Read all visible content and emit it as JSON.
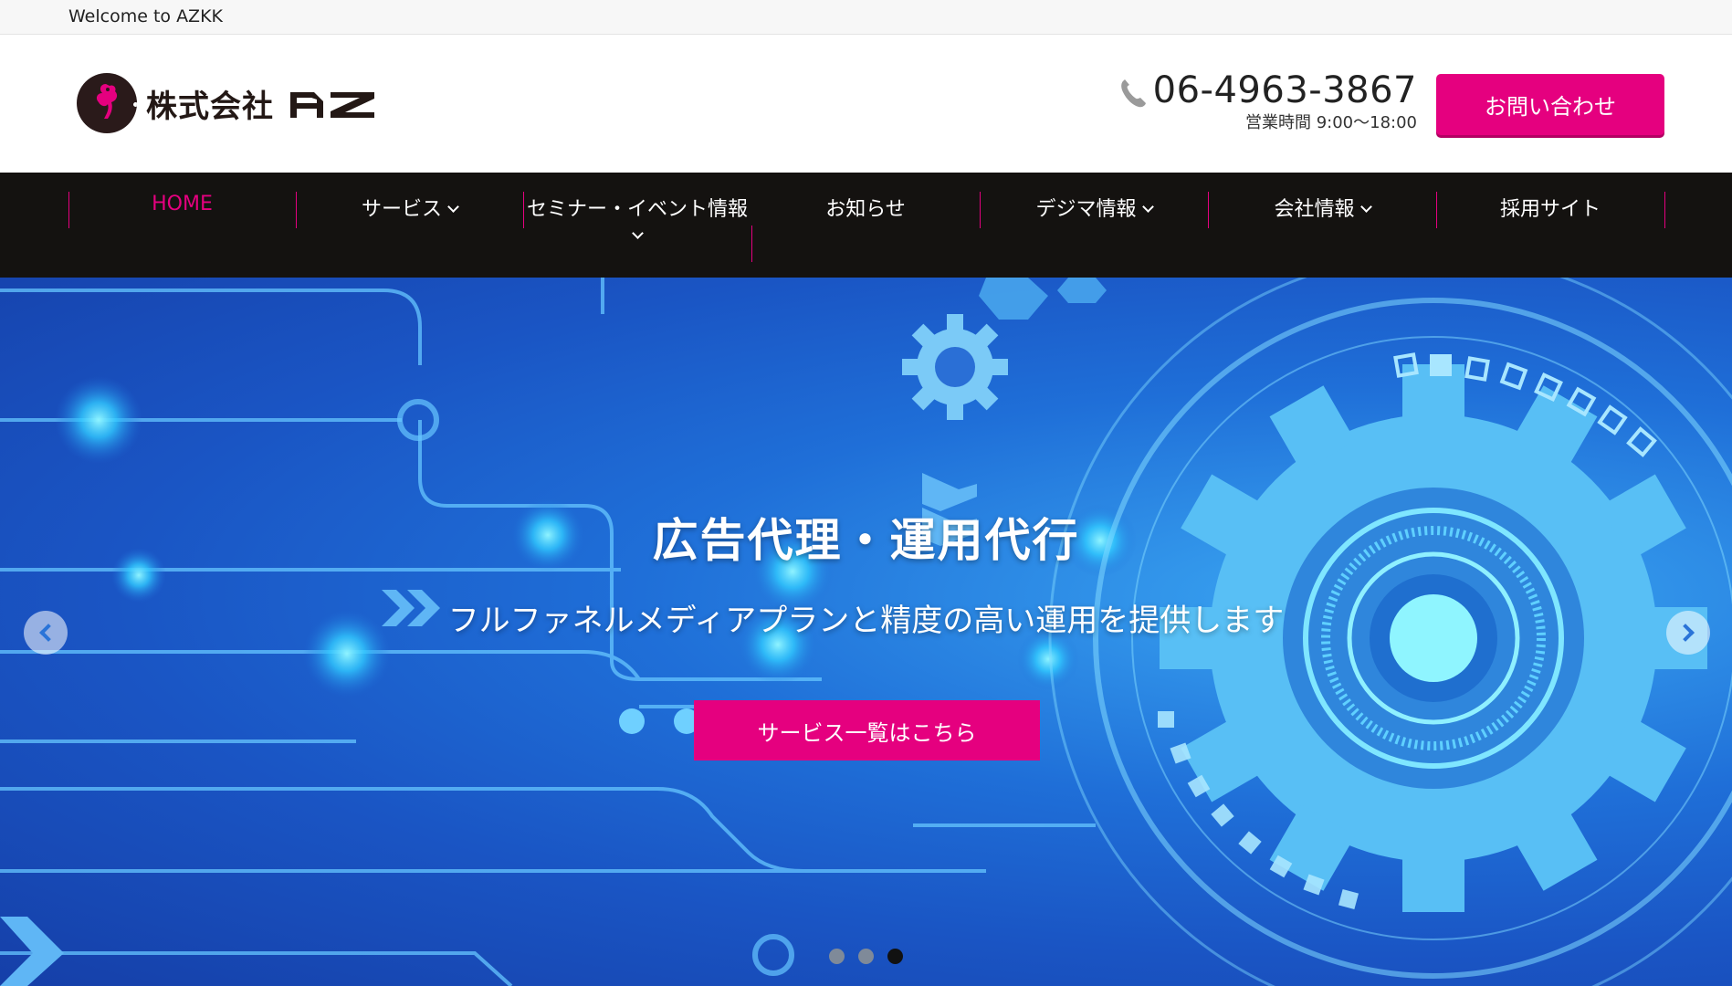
{
  "topbar": {
    "welcome": "Welcome to AZKK"
  },
  "header": {
    "logo_text": "株式会社",
    "logo_brand": "AZ",
    "phone": "06-4963-3867",
    "hours": "営業時間 9:00～18:00",
    "contact_label": "お問い合わせ"
  },
  "nav": {
    "items": [
      {
        "label": "HOME",
        "dropdown": false,
        "active": true
      },
      {
        "label": "サービス",
        "dropdown": true
      },
      {
        "label": "セミナー・イベント情報",
        "dropdown": true
      },
      {
        "label": "お知らせ",
        "dropdown": false
      },
      {
        "label": "デジマ情報",
        "dropdown": true
      },
      {
        "label": "会社情報",
        "dropdown": true
      },
      {
        "label": "採用サイト",
        "dropdown": false
      }
    ]
  },
  "hero": {
    "title": "広告代理・運用代行",
    "subtitle": "フルファネルメディアプランと精度の高い運用を提供します",
    "cta_label": "サービス一覧はこちら",
    "slides_count": 3,
    "active_slide": 3
  },
  "colors": {
    "accent": "#e5007f",
    "nav_bg": "#141210",
    "hero_blue": "#1f6fd8"
  }
}
